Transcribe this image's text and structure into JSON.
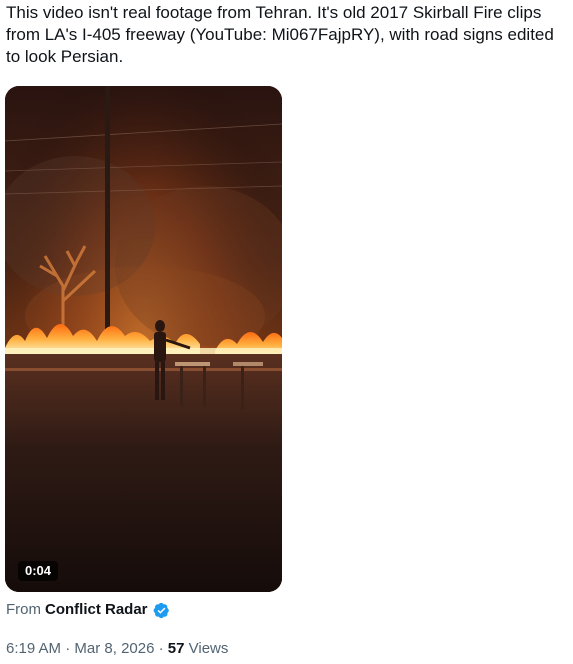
{
  "tweet": {
    "text_lines": [
      "This video isn't real footage from Tehran. It's old 2017 Skirball Fire clips",
      "from LA's I-405 freeway (YouTube: Mi067FajpRY), with road signs edited",
      "to look Persian."
    ]
  },
  "video": {
    "duration": "0:04"
  },
  "source": {
    "prefix": "From",
    "name": "Conflict Radar",
    "verified_icon": "verified-badge-icon",
    "verified_color": "#1d9bf0"
  },
  "meta": {
    "time": "6:19 AM",
    "separator1": " · ",
    "date": "Mar 8, 2026",
    "separator2": " · ",
    "views_count": "57",
    "views_label": " Views"
  },
  "colors": {
    "text_primary": "#0f1419",
    "text_secondary": "#536471",
    "fire": "#ff8a1a"
  }
}
